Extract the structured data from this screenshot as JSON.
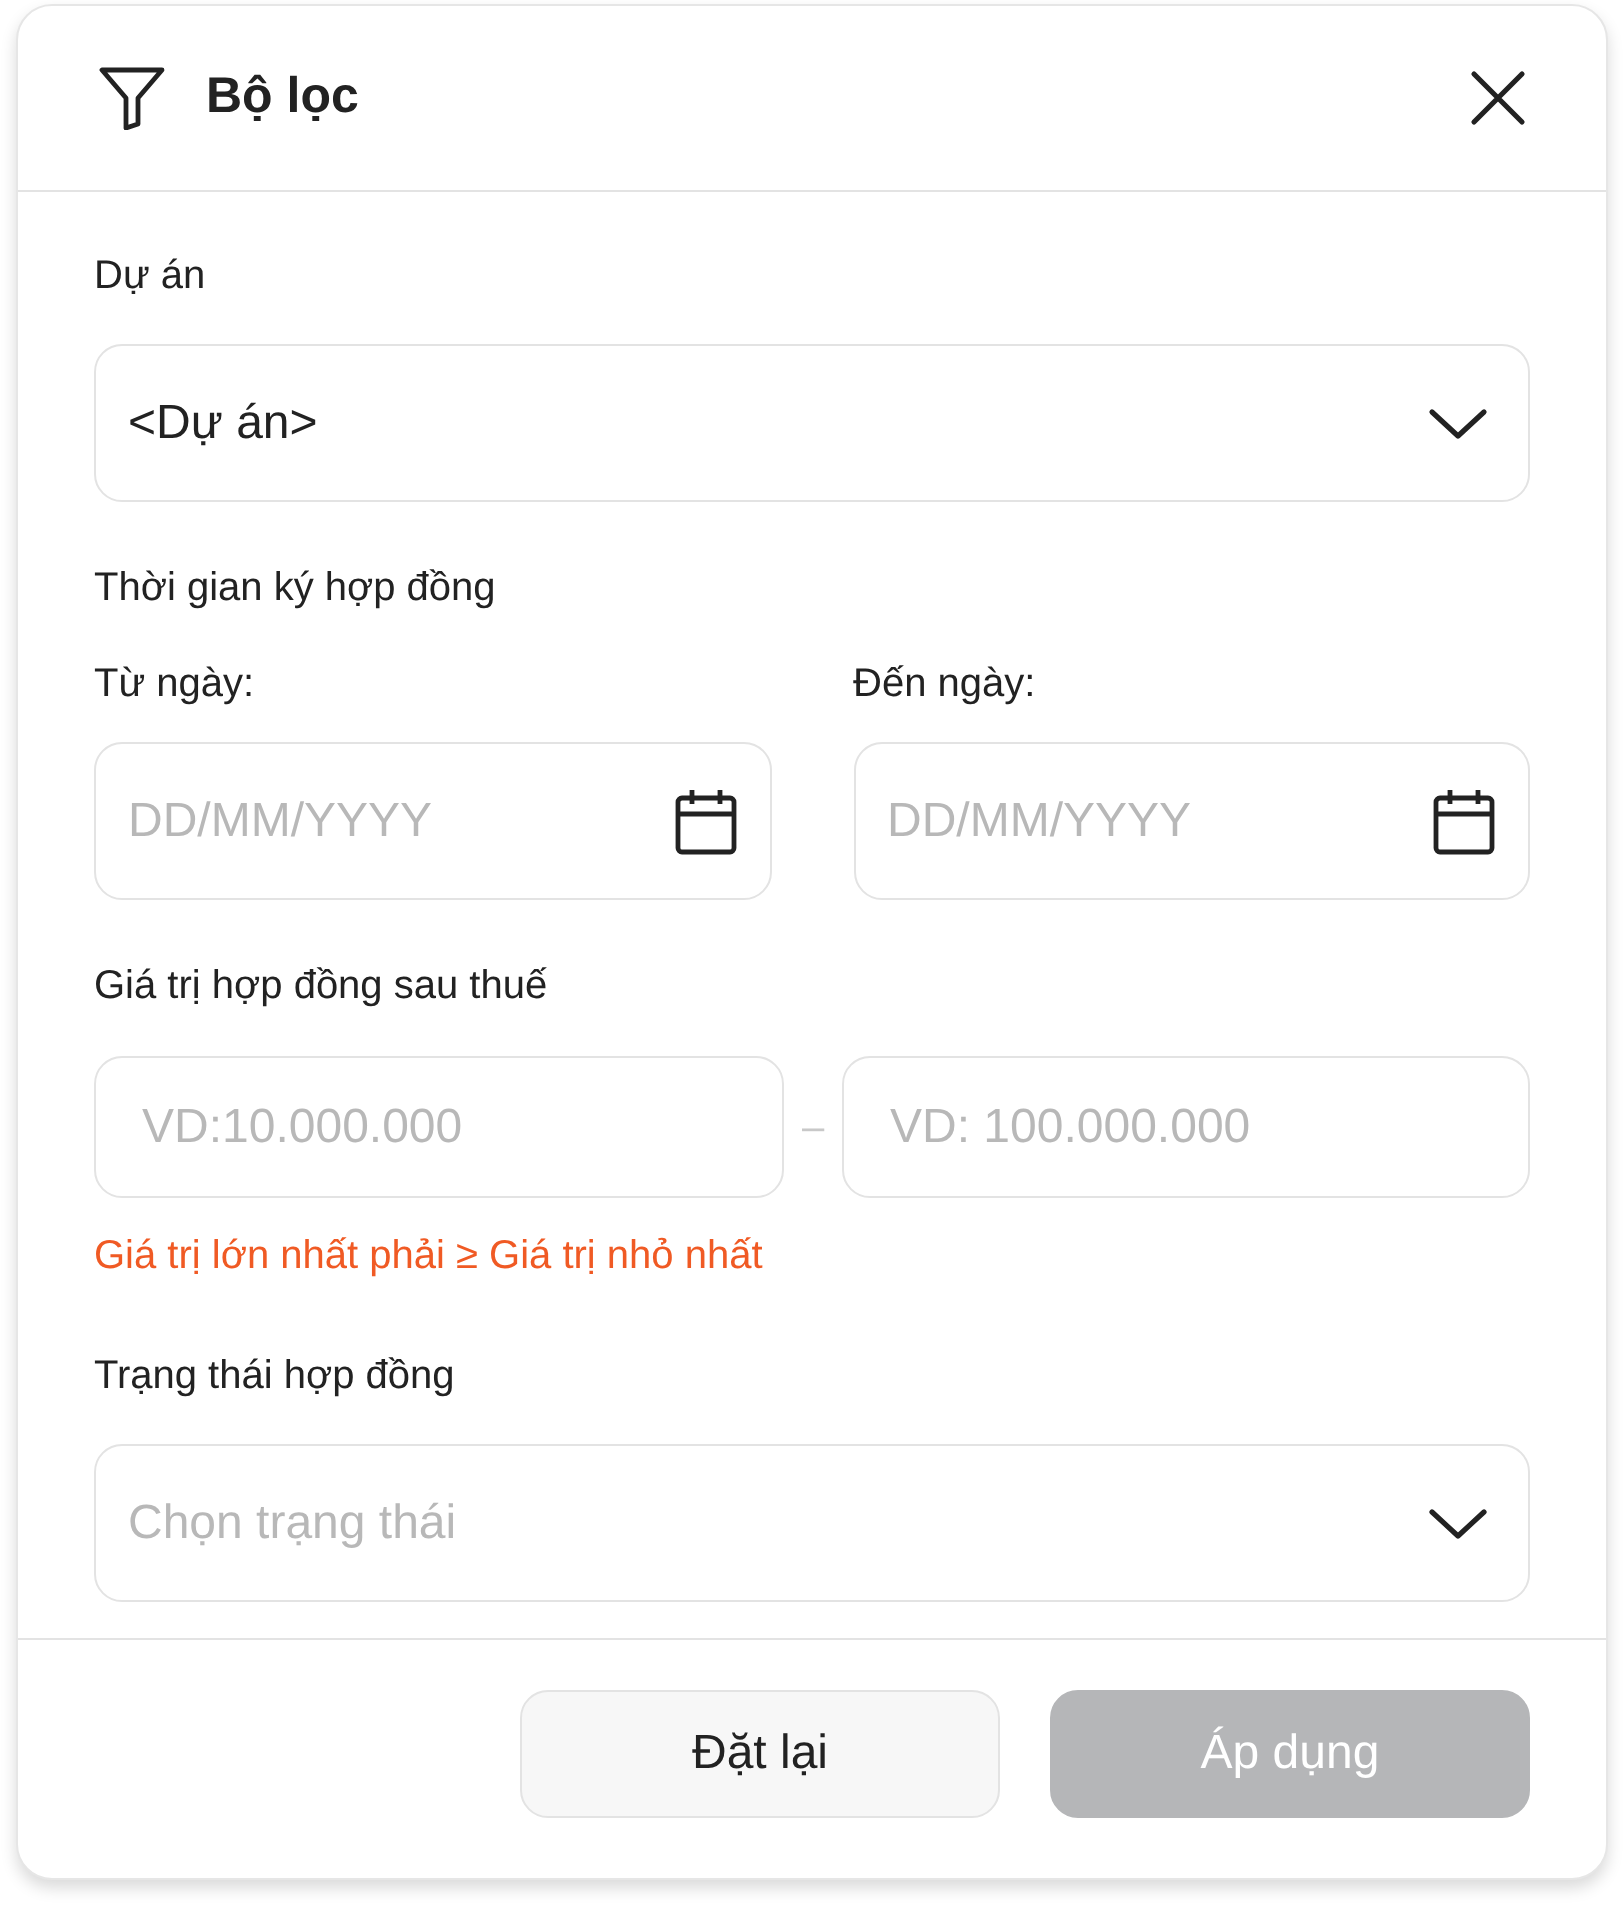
{
  "dialog": {
    "title": "Bộ lọc"
  },
  "project": {
    "label": "Dự án",
    "value": "<Dự án>"
  },
  "signing_period": {
    "label": "Thời gian ký hợp đồng",
    "from": {
      "label": "Từ ngày:",
      "placeholder": "DD/MM/YYYY"
    },
    "to": {
      "label": "Đến ngày:",
      "placeholder": "DD/MM/YYYY"
    }
  },
  "contract_value": {
    "label": "Giá trị hợp đồng sau thuế",
    "min": {
      "placeholder": "VD:10.000.000"
    },
    "separator": "–",
    "max": {
      "placeholder": "VD: 100.000.000"
    },
    "error": "Giá trị lớn nhất phải ≥ Giá trị nhỏ nhất"
  },
  "status": {
    "label": "Trạng thái hợp đồng",
    "placeholder": "Chọn trạng thái"
  },
  "buttons": [
    {
      "label": "Đặt lại",
      "disabled": false
    },
    {
      "label": "Áp dụng",
      "disabled": true
    }
  ]
}
